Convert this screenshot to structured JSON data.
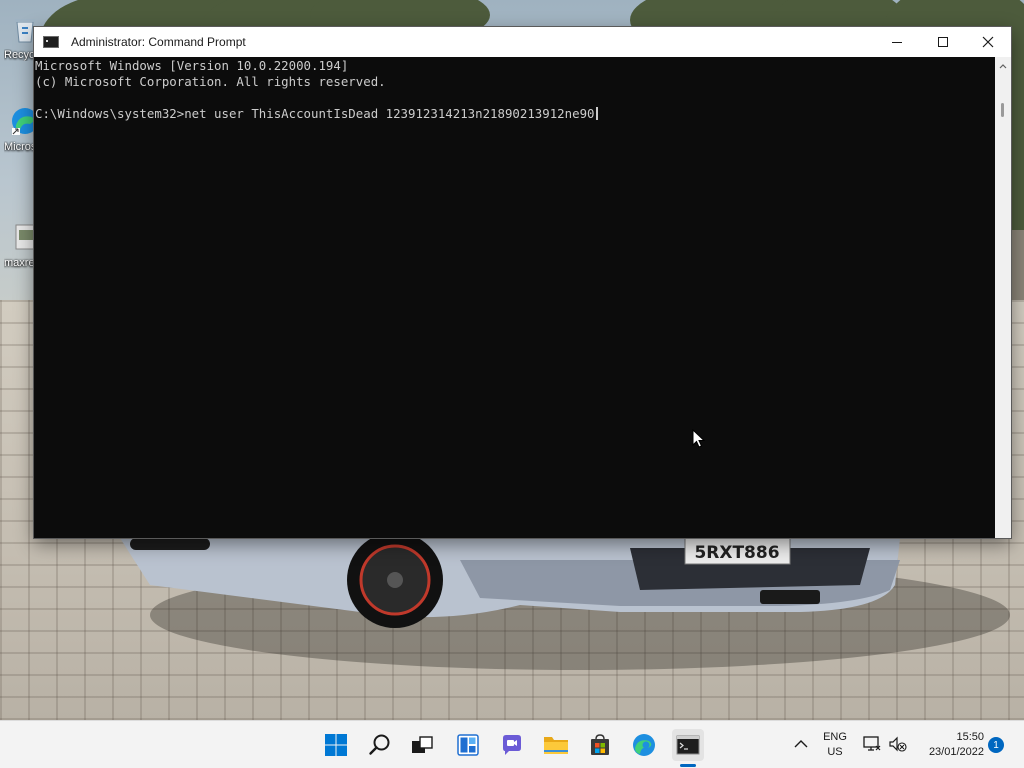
{
  "desktop": {
    "icons": [
      {
        "label": "Recycle Bin",
        "icon": "recycle-bin-icon"
      },
      {
        "label": "Microsoft Edge",
        "icon": "edge-icon"
      },
      {
        "label": "maxresdefault",
        "icon": "image-file-icon"
      }
    ],
    "plate_text": "5RXT886"
  },
  "window": {
    "title": "Administrator: Command Prompt",
    "controls": {
      "minimize": "minimize-icon",
      "maximize": "maximize-icon",
      "close": "close-icon"
    },
    "console": {
      "lines": [
        "Microsoft Windows [Version 10.0.22000.194]",
        "(c) Microsoft Corporation. All rights reserved.",
        "",
        "C:\\Windows\\system32>net user ThisAccountIsDead 123912314213n21890213912ne90"
      ],
      "foreground": "#cccccc",
      "background": "#0c0c0c"
    }
  },
  "taskbar": {
    "apps": [
      {
        "name": "Start",
        "icon": "windows-start-icon",
        "active": false
      },
      {
        "name": "Search",
        "icon": "search-icon",
        "active": false
      },
      {
        "name": "Task View",
        "icon": "task-view-icon",
        "active": false
      },
      {
        "name": "Widgets",
        "icon": "widgets-icon",
        "active": false
      },
      {
        "name": "Chat",
        "icon": "chat-icon",
        "active": false
      },
      {
        "name": "File Explorer",
        "icon": "folder-icon",
        "active": false
      },
      {
        "name": "Microsoft Store",
        "icon": "store-icon",
        "active": false
      },
      {
        "name": "Microsoft Edge",
        "icon": "edge-icon",
        "active": false
      },
      {
        "name": "Command Prompt",
        "icon": "terminal-icon",
        "active": true
      }
    ],
    "tray": {
      "language": "ENG",
      "region": "US",
      "time": "15:50",
      "date": "23/01/2022",
      "notification_count": "1"
    },
    "accent": "#0067c0"
  }
}
